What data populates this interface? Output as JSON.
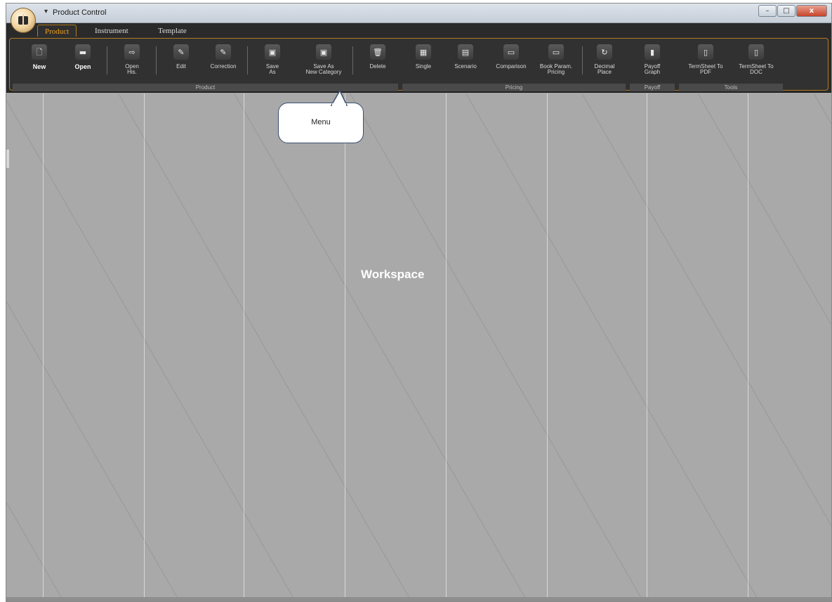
{
  "window": {
    "title": "Product Control",
    "controls": {
      "minimize": "–",
      "maximize": "□",
      "close": "x"
    }
  },
  "tabs": [
    {
      "label": "Product",
      "active": true
    },
    {
      "label": "Instrument",
      "active": false
    },
    {
      "label": "Template",
      "active": false
    }
  ],
  "ribbon": {
    "groups": {
      "product": "Product",
      "pricing": "Pricing",
      "payoff": "Payoff",
      "tools": "Tools"
    },
    "buttons": {
      "new": "New",
      "open": "Open",
      "open_his": "Open\nHis.",
      "edit": "Edit",
      "correction": "Correction",
      "save_as": "Save\nAs",
      "save_as_new_category": "Save As\nNew Category",
      "delete": "Delete",
      "single": "Single",
      "scenario": "Scenario",
      "comparison": "Comparison",
      "book_param_pricing": "Book Param.\nPricing",
      "decimal_place": "Decimal\nPlace",
      "payoff_graph": "Payoff\nGraph",
      "termsheet_pdf": "TermSheet To\nPDF",
      "termsheet_doc": "TermSheet To\nDOC"
    }
  },
  "callout": {
    "text": "Menu"
  },
  "workspace": {
    "label": "Workspace"
  },
  "colors": {
    "accent": "#f0a020",
    "ribbon_bg": "#2b2b2b",
    "workspace_bg": "#a9a9a9"
  }
}
